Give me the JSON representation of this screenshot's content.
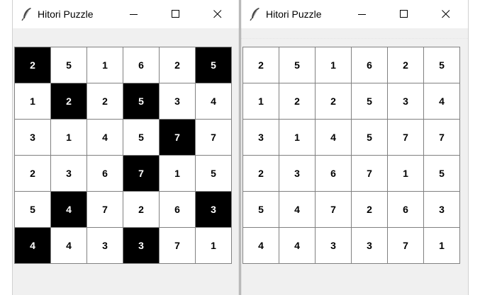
{
  "windows": [
    {
      "title": "Hitori Puzzle",
      "icon": "feather-icon",
      "grid": [
        [
          2,
          5,
          1,
          6,
          2,
          5
        ],
        [
          1,
          2,
          2,
          5,
          3,
          4
        ],
        [
          3,
          1,
          4,
          5,
          7,
          7
        ],
        [
          2,
          3,
          6,
          7,
          1,
          5
        ],
        [
          5,
          4,
          7,
          2,
          6,
          3
        ],
        [
          4,
          4,
          3,
          3,
          7,
          1
        ]
      ],
      "shaded": [
        [
          true,
          false,
          false,
          false,
          false,
          true
        ],
        [
          false,
          true,
          false,
          true,
          false,
          false
        ],
        [
          false,
          false,
          false,
          false,
          true,
          false
        ],
        [
          false,
          false,
          false,
          true,
          false,
          false
        ],
        [
          false,
          true,
          false,
          false,
          false,
          true
        ],
        [
          true,
          false,
          false,
          true,
          false,
          false
        ]
      ]
    },
    {
      "title": "Hitori Puzzle",
      "icon": "feather-icon",
      "grid": [
        [
          2,
          5,
          1,
          6,
          2,
          5
        ],
        [
          1,
          2,
          2,
          5,
          3,
          4
        ],
        [
          3,
          1,
          4,
          5,
          7,
          7
        ],
        [
          2,
          3,
          6,
          7,
          1,
          5
        ],
        [
          5,
          4,
          7,
          2,
          6,
          3
        ],
        [
          4,
          4,
          3,
          3,
          7,
          1
        ]
      ],
      "shaded": [
        [
          false,
          false,
          false,
          false,
          false,
          false
        ],
        [
          false,
          false,
          false,
          false,
          false,
          false
        ],
        [
          false,
          false,
          false,
          false,
          false,
          false
        ],
        [
          false,
          false,
          false,
          false,
          false,
          false
        ],
        [
          false,
          false,
          false,
          false,
          false,
          false
        ],
        [
          false,
          false,
          false,
          false,
          false,
          false
        ]
      ]
    }
  ],
  "colors": {
    "shaded_cell": "#000000",
    "cell": "#ffffff",
    "grid_line": "#808080",
    "window_bg": "#f0f0f0",
    "titlebar_bg": "#ffffff"
  }
}
